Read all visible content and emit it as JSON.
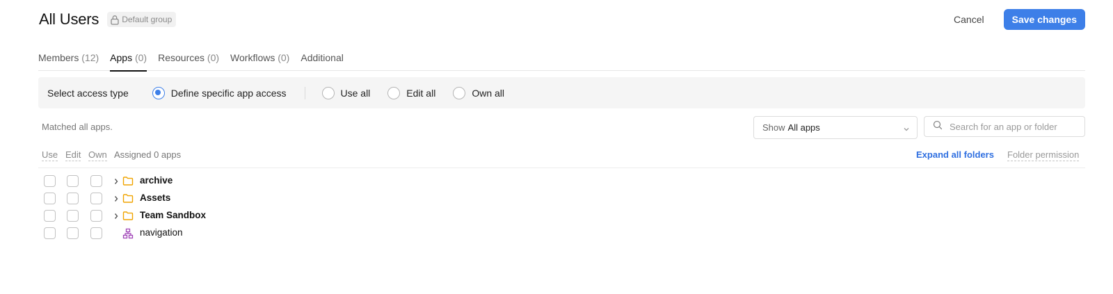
{
  "header": {
    "title": "All Users",
    "badge_label": "Default group",
    "cancel_label": "Cancel",
    "save_label": "Save changes"
  },
  "tabs": [
    {
      "label": "Members",
      "count": "(12)",
      "active": false
    },
    {
      "label": "Apps",
      "count": "(0)",
      "active": true
    },
    {
      "label": "Resources",
      "count": "(0)",
      "active": false
    },
    {
      "label": "Workflows",
      "count": "(0)",
      "active": false
    },
    {
      "label": "Additional",
      "count": "",
      "active": false
    }
  ],
  "access": {
    "label": "Select access type",
    "options": [
      {
        "label": "Define specific app access",
        "checked": true
      },
      {
        "label": "Use all",
        "checked": false
      },
      {
        "label": "Edit all",
        "checked": false
      },
      {
        "label": "Own all",
        "checked": false
      }
    ]
  },
  "filters": {
    "matched_text": "Matched all apps.",
    "show_prefix": "Show",
    "show_value": "All apps",
    "search_placeholder": "Search for an app or folder"
  },
  "list_header": {
    "use": "Use",
    "edit": "Edit",
    "own": "Own",
    "assigned": "Assigned 0 apps",
    "expand_all": "Expand all folders",
    "folder_permission": "Folder permission"
  },
  "items": [
    {
      "name": "archive",
      "type": "folder"
    },
    {
      "name": "Assets",
      "type": "folder"
    },
    {
      "name": "Team Sandbox",
      "type": "folder"
    },
    {
      "name": "navigation",
      "type": "module"
    }
  ],
  "colors": {
    "accent": "#3d7fe8",
    "folder": "#f0a400",
    "module": "#a044b8",
    "link": "#2f6fe0"
  }
}
